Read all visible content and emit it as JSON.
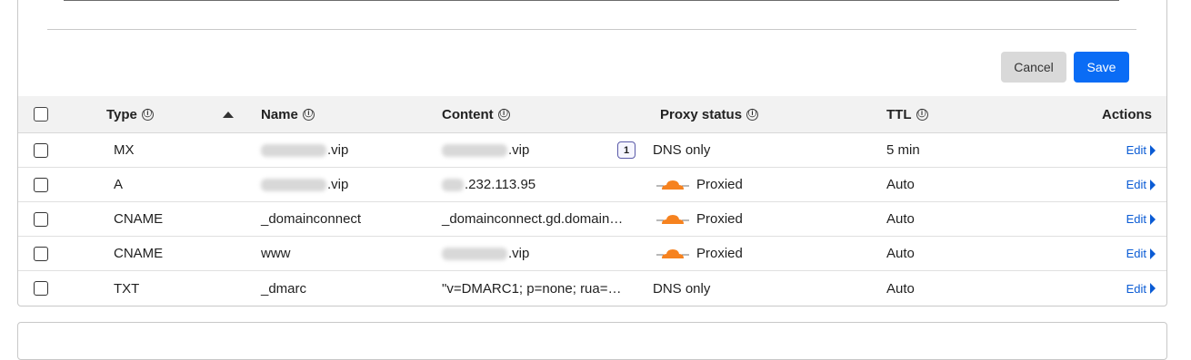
{
  "actions": {
    "cancel_label": "Cancel",
    "save_label": "Save"
  },
  "table": {
    "headers": {
      "type": "Type",
      "name": "Name",
      "content": "Content",
      "proxy_status": "Proxy status",
      "ttl": "TTL",
      "actions": "Actions"
    },
    "info_glyph": "ⓘ",
    "edit_label": "Edit",
    "rows": [
      {
        "type": "MX",
        "name": ".vip",
        "content": ".vip",
        "badge": "1",
        "proxy": "DNS only",
        "ttl": "5 min"
      },
      {
        "type": "A",
        "name": ".vip",
        "content": ".232.113.95",
        "proxy": "Proxied",
        "ttl": "Auto"
      },
      {
        "type": "CNAME",
        "name": "_domainconnect",
        "content": "_domainconnect.gd.domain…",
        "proxy": "Proxied",
        "ttl": "Auto"
      },
      {
        "type": "CNAME",
        "name": "www",
        "content": ".vip",
        "proxy": "Proxied",
        "ttl": "Auto"
      },
      {
        "type": "TXT",
        "name": "_dmarc",
        "content": "\"v=DMARC1; p=none; rua=…",
        "proxy": "DNS only",
        "ttl": "Auto"
      }
    ]
  },
  "colors": {
    "accent": "#0a6cf5",
    "link": "#0a5bd4",
    "proxied_cloud": "#f6821f"
  },
  "icons": {
    "sort": "sort-ascending-icon",
    "proxy": "proxied-cloud-icon",
    "edit": "chevron-right-icon"
  }
}
